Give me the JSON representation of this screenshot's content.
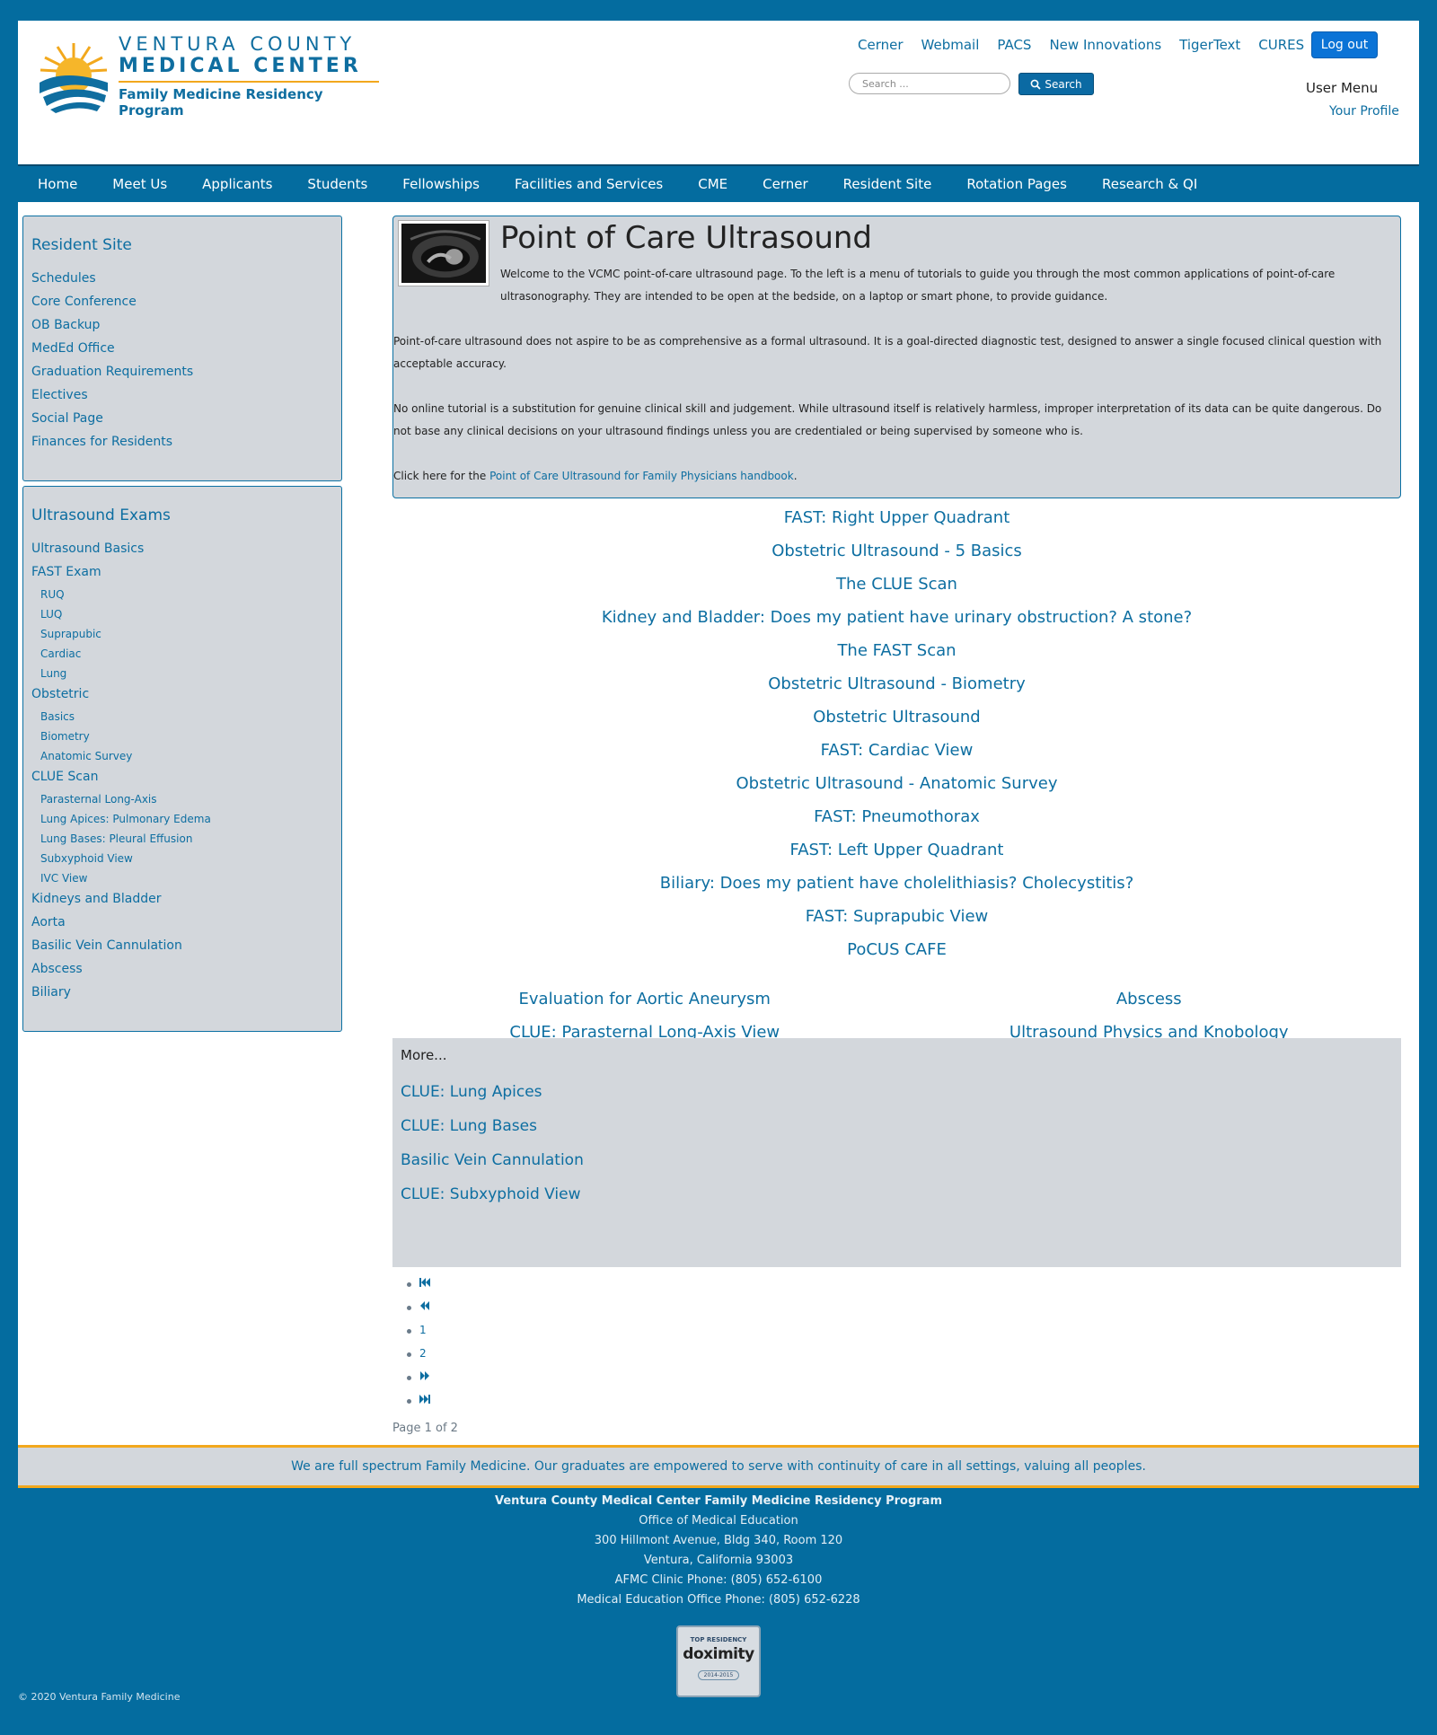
{
  "logo": {
    "line1": "VENTURA COUNTY",
    "line2": "MEDICAL CENTER",
    "line3": "Family Medicine Residency Program"
  },
  "topnav": {
    "links": [
      "Cerner",
      "Webmail",
      "PACS",
      "New Innovations",
      "TigerText",
      "CURES"
    ],
    "logout_label": "Log out",
    "search_placeholder": "Search ...",
    "search_button": "Search"
  },
  "usermenu": {
    "title": "User Menu",
    "profile": "Your Profile"
  },
  "mainnav": [
    "Home",
    "Meet Us",
    "Applicants",
    "Students",
    "Fellowships",
    "Facilities and Services",
    "CME",
    "Cerner",
    "Resident Site",
    "Rotation Pages",
    "Research & QI"
  ],
  "sidebar": {
    "resident": {
      "title": "Resident Site",
      "items": [
        "Schedules",
        "Core Conference",
        "OB Backup",
        "MedEd Office",
        "Graduation Requirements",
        "Electives",
        "Social Page",
        "Finances for Residents"
      ]
    },
    "ultrasound": {
      "title": "Ultrasound Exams",
      "items": [
        {
          "label": "Ultrasound Basics",
          "level": 0
        },
        {
          "label": "FAST Exam",
          "level": 0
        },
        {
          "label": "RUQ",
          "level": 1
        },
        {
          "label": "LUQ",
          "level": 1
        },
        {
          "label": "Suprapubic",
          "level": 1
        },
        {
          "label": "Cardiac",
          "level": 1
        },
        {
          "label": "Lung",
          "level": 1
        },
        {
          "label": "Obstetric",
          "level": 0
        },
        {
          "label": "Basics",
          "level": 1
        },
        {
          "label": "Biometry",
          "level": 1
        },
        {
          "label": "Anatomic Survey",
          "level": 1
        },
        {
          "label": "CLUE Scan",
          "level": 0
        },
        {
          "label": "Parasternal Long-Axis",
          "level": 1
        },
        {
          "label": "Lung Apices: Pulmonary Edema",
          "level": 1
        },
        {
          "label": "Lung Bases: Pleural Effusion",
          "level": 1
        },
        {
          "label": "Subxyphoid View",
          "level": 1
        },
        {
          "label": "IVC View",
          "level": 1
        },
        {
          "label": "Kidneys and Bladder",
          "level": 0
        },
        {
          "label": "Aorta",
          "level": 0
        },
        {
          "label": "Basilic Vein Cannulation",
          "level": 0
        },
        {
          "label": "Abscess",
          "level": 0
        },
        {
          "label": "Biliary",
          "level": 0
        }
      ]
    }
  },
  "article": {
    "title": "Point of Care Ultrasound",
    "p1": "Welcome to the VCMC point-of-care ultrasound page.  To the left is a menu of tutorials to guide you through the most common applications of point-of-care ultrasonography.  They are intended to be open at the bedside, on a laptop or smart phone, to provide guidance.",
    "p2": "Point-of-care ultrasound does not aspire to be as comprehensive as a formal ultrasound.  It is a goal-directed diagnostic test, designed to answer a single focused clinical question with acceptable accuracy.",
    "p3": "No online tutorial is a substitution for genuine clinical skill and judgement.  While ultrasound itself is relatively harmless, improper interpretation of its data can be quite dangerous.  Do not base any clinical decisions on your ultrasound findings unless you are credentialed or being supervised by someone who is.",
    "p4_prefix": "Click here for the ",
    "p4_link": "Point of Care Ultrasound for Family Physicians handbook",
    "p4_suffix": "."
  },
  "featured_links": [
    "FAST: Right Upper Quadrant",
    "Obstetric Ultrasound - 5 Basics",
    "The CLUE Scan",
    "Kidney and Bladder: Does my patient have urinary obstruction? A stone?",
    "The FAST Scan",
    "Obstetric Ultrasound - Biometry",
    "Obstetric Ultrasound",
    "FAST: Cardiac View",
    "Obstetric Ultrasound - Anatomic Survey",
    "FAST: Pneumothorax",
    "FAST: Left Upper Quadrant",
    "Biliary: Does my patient have cholelithiasis? Cholecystitis?",
    "FAST: Suprapubic View",
    "PoCUS CAFE"
  ],
  "two_col_links": [
    [
      "Evaluation for Aortic Aneurysm",
      "Abscess"
    ],
    [
      "CLUE: Parasternal Long-Axis View",
      "Ultrasound Physics and Knobology"
    ]
  ],
  "more": {
    "title": "More...",
    "links": [
      "CLUE: Lung Apices",
      "CLUE: Lung Bases",
      "Basilic Vein Cannulation",
      "CLUE: Subxyphoid View"
    ]
  },
  "pager": {
    "pages": [
      "1",
      "2"
    ],
    "count": "Page 1 of 2"
  },
  "footer": {
    "mission": "We are full spectrum Family Medicine. Our graduates are empowered to serve with continuity of care in all settings, valuing all peoples.",
    "org": "Ventura County Medical Center Family Medicine Residency Program",
    "lines": [
      "Office of Medical Education",
      "300 Hillmont Avenue, Bldg 340, Room 120",
      "Ventura, California 93003",
      "AFMC Clinic Phone: (805) 652-6100",
      "Medical Education Office Phone: (805) 652-6228"
    ],
    "badge_top": "TOP RESIDENCY",
    "badge_name": "doximity",
    "badge_years": "2014-2015",
    "copyright": "© 2020 Ventura Family Medicine"
  }
}
